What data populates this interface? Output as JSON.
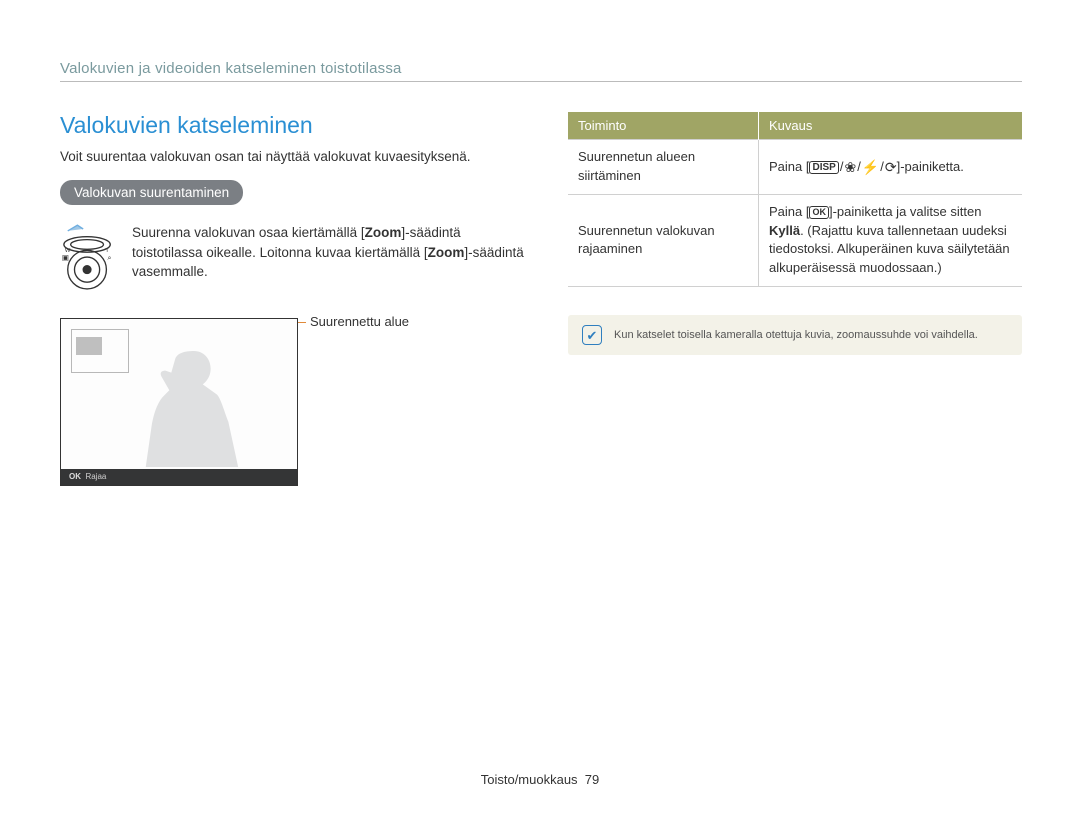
{
  "header": "Valokuvien ja videoiden katseleminen toistotilassa",
  "left": {
    "title": "Valokuvien katseleminen",
    "intro": "Voit suurentaa valokuvan osan tai näyttää valokuvat kuvaesityksenä.",
    "subheading": "Valokuvan suurentaminen",
    "zoom_text_1": "Suurenna valokuvan osaa kiertämällä [",
    "zoom_bold_1": "Zoom",
    "zoom_text_2": "]-säädintä toistotilassa oikealle. Loitonna kuvaa kiertämällä [",
    "zoom_bold_2": "Zoom",
    "zoom_text_3": "]-säädintä vasemmalle.",
    "annotation": "Suurennettu alue",
    "preview_footer_ok": "OK",
    "preview_footer_label": "Rajaa"
  },
  "table": {
    "col1": "Toiminto",
    "col2": "Kuvaus",
    "rows": [
      {
        "left": "Suurennetun alueen siirtäminen",
        "right_prefix": "Paina [",
        "right_suffix": "]-painiketta."
      },
      {
        "left": "Suurennetun valokuvan rajaaminen",
        "right_prefix": "Paina [",
        "right_mid1": "]-painiketta ja valitse sitten ",
        "right_bold": "Kyllä",
        "right_mid2": ". (Rajattu kuva tallennetaan uudeksi tiedostoksi. Alkuperäinen kuva säilytetään alkuperäisessä muodossaan.)"
      }
    ]
  },
  "note": "Kun katselet toisella kameralla otettuja kuvia, zoomaussuhde voi vaihdella.",
  "footer": {
    "section": "Toisto/muokkaus",
    "page": "79"
  }
}
